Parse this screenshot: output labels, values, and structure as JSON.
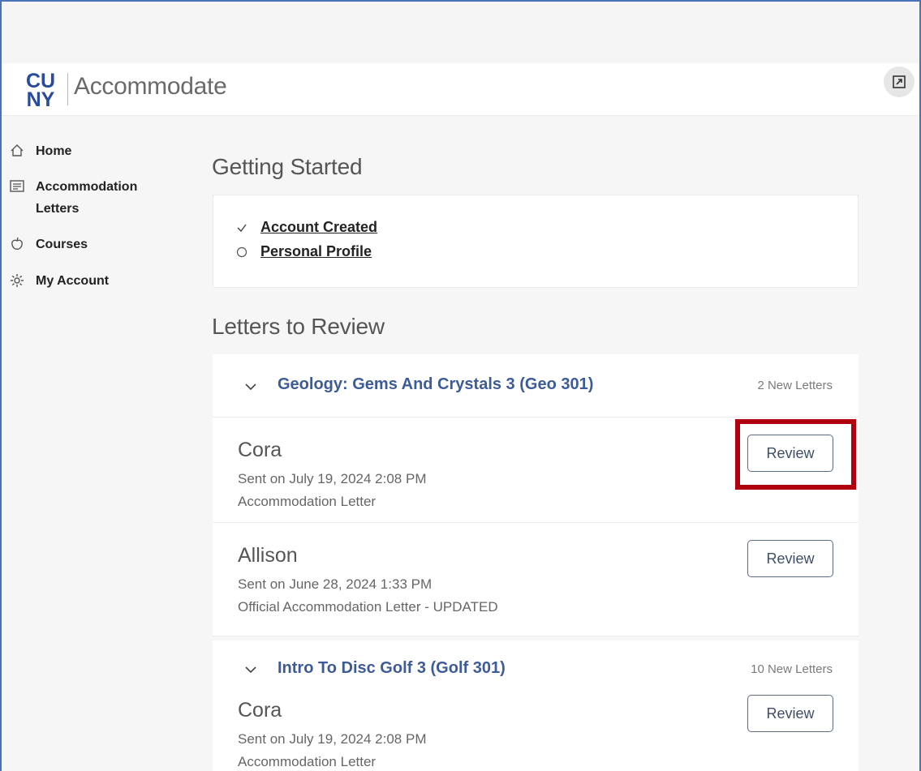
{
  "app": {
    "title": "Accommodate",
    "logo_text": "CUNY"
  },
  "sidebar": {
    "items": [
      {
        "label": "Home",
        "icon": "home-icon"
      },
      {
        "label": "Accommodation Letters",
        "icon": "letters-icon"
      },
      {
        "label": "Courses",
        "icon": "apple-icon"
      },
      {
        "label": "My Account",
        "icon": "gear-icon"
      }
    ]
  },
  "getting_started": {
    "title": "Getting Started",
    "items": [
      {
        "label": "Account Created",
        "status": "complete"
      },
      {
        "label": "Personal Profile",
        "status": "incomplete"
      }
    ]
  },
  "letters_to_review": {
    "title": "Letters to Review",
    "groups": [
      {
        "course": "Geology: Gems And Crystals 3 (Geo 301)",
        "count_label": "2 New Letters",
        "letters": [
          {
            "name": "Cora",
            "sent": "Sent on July 19, 2024 2:08 PM",
            "type": "Accommodation Letter",
            "action": "Review"
          },
          {
            "name": "Allison",
            "sent": "Sent on June 28, 2024 1:33 PM",
            "type": "Official Accommodation Letter - UPDATED",
            "action": "Review"
          }
        ]
      },
      {
        "course": "Intro To Disc Golf 3 (Golf 301)",
        "count_label": "10 New Letters",
        "letters": [
          {
            "name": "Cora",
            "sent": "Sent on July 19, 2024 2:08 PM",
            "type": "Accommodation Letter",
            "action": "Review"
          }
        ]
      }
    ]
  },
  "colors": {
    "accent": "#3d5b96",
    "highlight": "#b00010",
    "logo_blue": "#2a4b9b"
  }
}
